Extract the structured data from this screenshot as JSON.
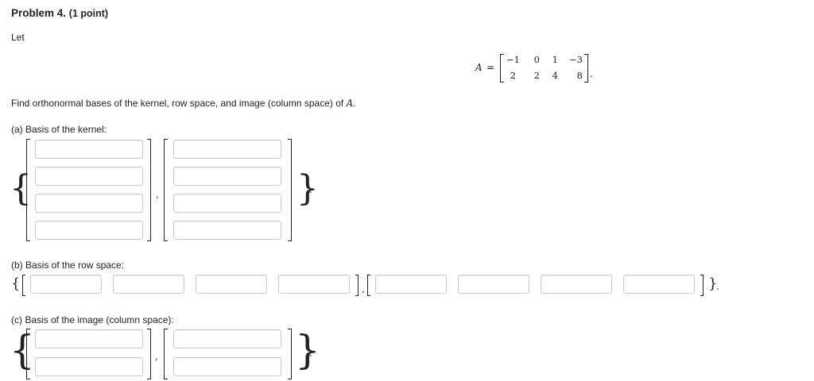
{
  "problem": {
    "title": "Problem 4.",
    "points": "(1 point)",
    "let_text": "Let",
    "prompt_text": "Find orthonormal bases of the kernel, row space, and image (column space) of",
    "prompt_var": "A",
    "prompt_end": "."
  },
  "matrix": {
    "name": "A",
    "equals": "=",
    "rows": [
      [
        "−1",
        "0",
        "1",
        "−3"
      ],
      [
        "2",
        "2",
        "4",
        "8"
      ]
    ],
    "end_punct": "."
  },
  "parts": {
    "kernel": {
      "label": "(a) Basis of the kernel:"
    },
    "row_space": {
      "label": "(b) Basis of the row space:"
    },
    "image": {
      "label": "(c) Basis of the image (column space):"
    }
  },
  "punct": {
    "comma": ",",
    "period": "."
  }
}
